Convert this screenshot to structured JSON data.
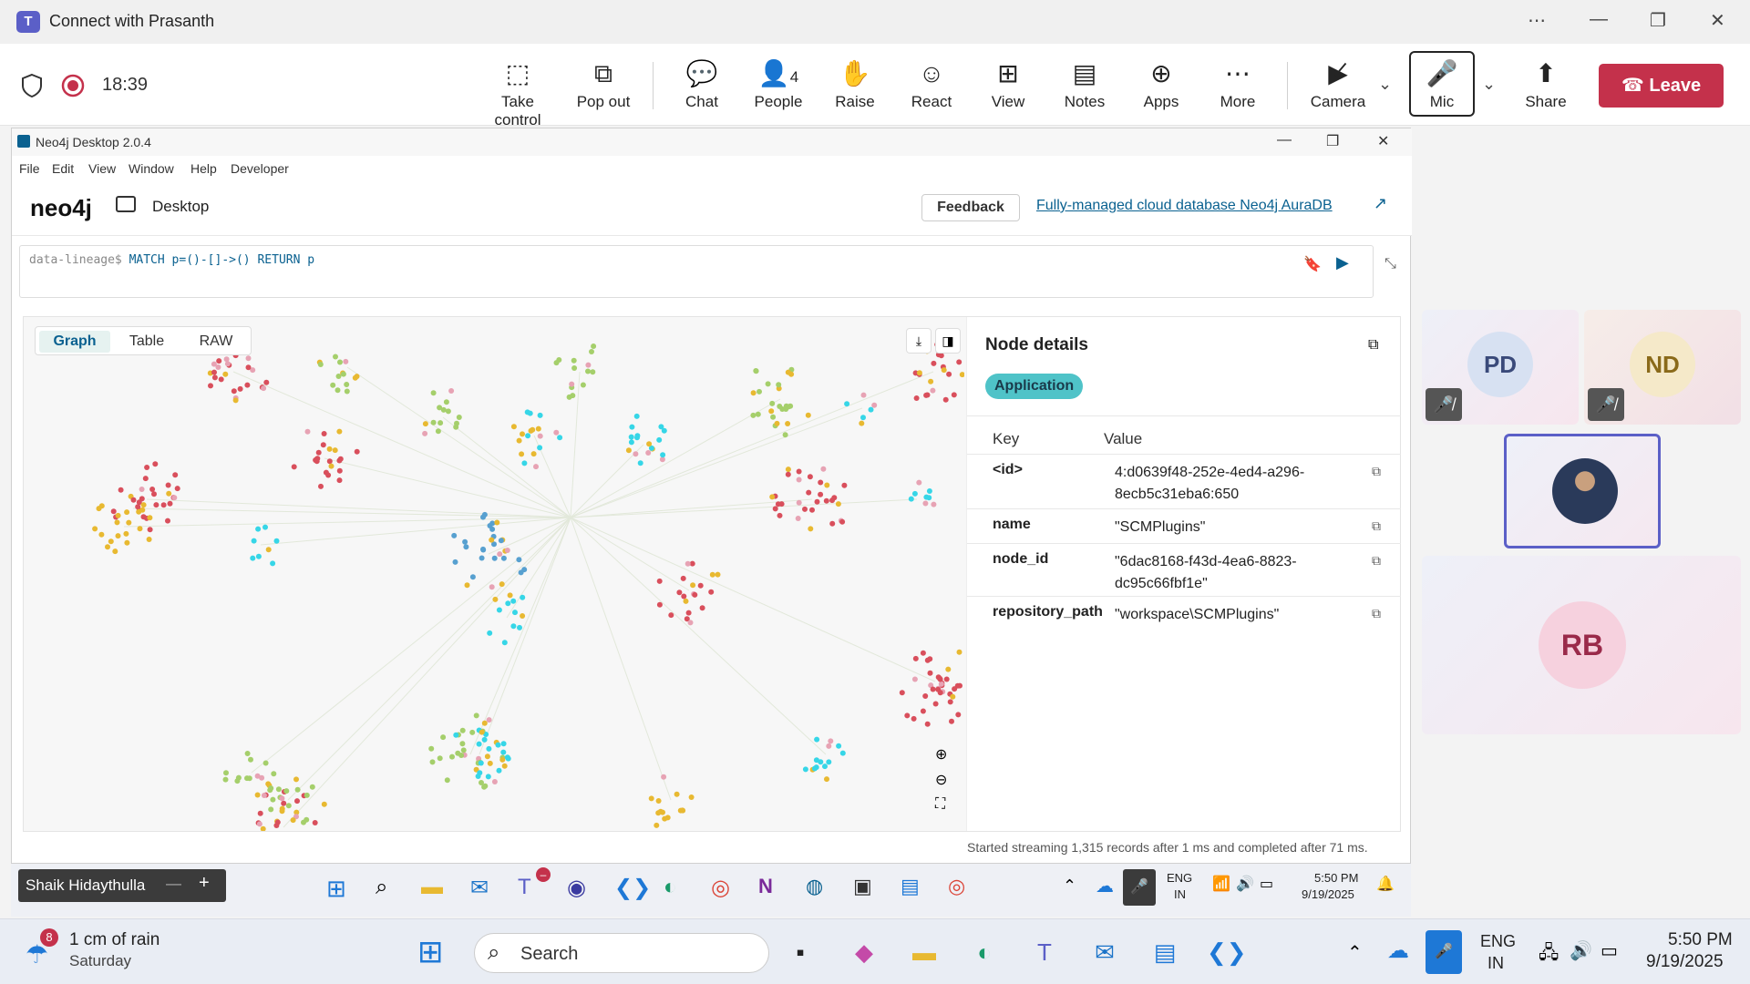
{
  "teams": {
    "window_title": "Connect with Prasanth",
    "logo_letter": "T",
    "recording_time": "18:39",
    "toolbar": [
      {
        "label": "Take control",
        "icon": "take-control-icon"
      },
      {
        "label": "Pop out",
        "icon": "pop-out-icon"
      },
      {
        "label": "Chat",
        "icon": "chat-icon"
      },
      {
        "label": "People",
        "icon": "people-icon",
        "count": "4"
      },
      {
        "label": "Raise",
        "icon": "raise-hand-icon"
      },
      {
        "label": "React",
        "icon": "react-icon"
      },
      {
        "label": "View",
        "icon": "view-icon"
      },
      {
        "label": "Notes",
        "icon": "notes-icon"
      },
      {
        "label": "Apps",
        "icon": "apps-icon"
      },
      {
        "label": "More",
        "icon": "more-icon"
      },
      {
        "label": "Camera",
        "icon": "camera-off-icon"
      },
      {
        "label": "Mic",
        "icon": "mic-icon"
      },
      {
        "label": "Share",
        "icon": "share-icon"
      }
    ],
    "leave_label": "Leave",
    "participants": [
      {
        "initials": "PD",
        "muted": true,
        "bg": "#d7e1f2"
      },
      {
        "initials": "ND",
        "muted": true,
        "bg": "#f5e9c9"
      },
      {
        "initials": "RB",
        "muted": false,
        "bg": "#f6d1de"
      }
    ],
    "accent": "#5b5fc7",
    "leave_color": "#c4314b"
  },
  "neo4j": {
    "window_title": "Neo4j Desktop 2.0.4",
    "menu": [
      "File",
      "Edit",
      "View",
      "Window",
      "Help",
      "Developer"
    ],
    "brand": "neo4j",
    "product": "Desktop",
    "feedback_label": "Feedback",
    "aura_link": "Fully-managed cloud database Neo4j AuraDB",
    "editor": {
      "prompt": "data-lineage$",
      "query": "MATCH p=()-[]->() RETURN p"
    },
    "tabs": [
      "Graph",
      "Table",
      "RAW"
    ],
    "active_tab": "Graph",
    "node_details": {
      "title": "Node details",
      "label": "Application",
      "key_header": "Key",
      "value_header": "Value",
      "rows": [
        {
          "key": "<id>",
          "value": "4:d0639f48-252e-4ed4-a296-8ecb5c31eba6:650"
        },
        {
          "key": "name",
          "value": "\"SCMPlugins\""
        },
        {
          "key": "node_id",
          "value": "\"6dac8168-f43d-4ea6-8823-dc95c66fbf1e\""
        },
        {
          "key": "repository_path",
          "value": "\"workspace\\SCMPlugins\""
        }
      ]
    },
    "status": "Started streaming 1,315 records after 1 ms and completed after 71 ms.",
    "node_colors": {
      "application": "#4fc3c8",
      "red": "#d94f5c",
      "green": "#a5cf6b",
      "yellow": "#e8b931",
      "pink": "#e7a3b4",
      "cyan": "#36d6e7",
      "blue": "#57a0d0"
    }
  },
  "inner_taskbar": {
    "presenter": "Shaik Hidaythulla",
    "language": "ENG",
    "region": "IN",
    "time": "5:50 PM",
    "date": "9/19/2025",
    "teams_badge": "–"
  },
  "taskbar": {
    "weather_title": "1 cm of rain",
    "weather_sub": "Saturday",
    "weather_badge": "8",
    "search_placeholder": "Search",
    "language": "ENG",
    "region": "IN",
    "time": "5:50 PM",
    "date": "9/19/2025"
  }
}
